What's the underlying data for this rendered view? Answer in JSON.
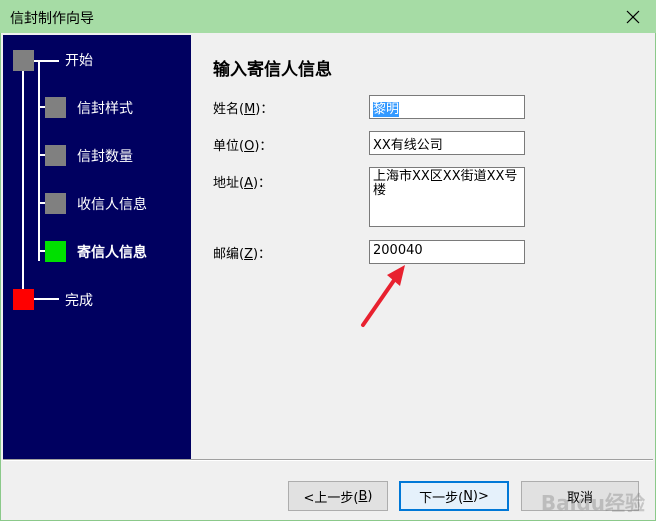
{
  "window": {
    "title": "信封制作向导"
  },
  "colors": {
    "title_bar": "#a6dca5",
    "steps_panel": "#000060",
    "step_done": "#808080",
    "step_current": "#00e000",
    "step_end": "#ff0000",
    "annotation_arrow": "#e8212f"
  },
  "steps": [
    {
      "label": "开始",
      "state": "done"
    },
    {
      "label": "信封样式",
      "state": "done"
    },
    {
      "label": "信封数量",
      "state": "done"
    },
    {
      "label": "收信人信息",
      "state": "done"
    },
    {
      "label": "寄信人信息",
      "state": "current"
    },
    {
      "label": "完成",
      "state": "end"
    }
  ],
  "content": {
    "heading": "输入寄信人信息",
    "fields": {
      "name": {
        "label_prefix": "姓名(",
        "hotkey": "M",
        "label_suffix": ")：",
        "value": "黎明"
      },
      "company": {
        "label_prefix": "单位(",
        "hotkey": "O",
        "label_suffix": ")：",
        "value": "XX有线公司"
      },
      "address": {
        "label_prefix": "地址(",
        "hotkey": "A",
        "label_suffix": ")：",
        "value": "上海市XX区XX街道XX号楼"
      },
      "zipcode": {
        "label_prefix": "邮编(",
        "hotkey": "Z",
        "label_suffix": ")：",
        "value": "200040"
      }
    }
  },
  "buttons": {
    "back": {
      "prefix": "<上一步(",
      "hotkey": "B",
      "suffix": ")"
    },
    "next": {
      "prefix": "下一步(",
      "hotkey": "N",
      "suffix": ")>"
    },
    "cancel": {
      "label": "取消"
    }
  },
  "icons": {
    "close": "close-icon",
    "arrow": "annotation-arrow-icon"
  },
  "watermark": "Baidu经验"
}
